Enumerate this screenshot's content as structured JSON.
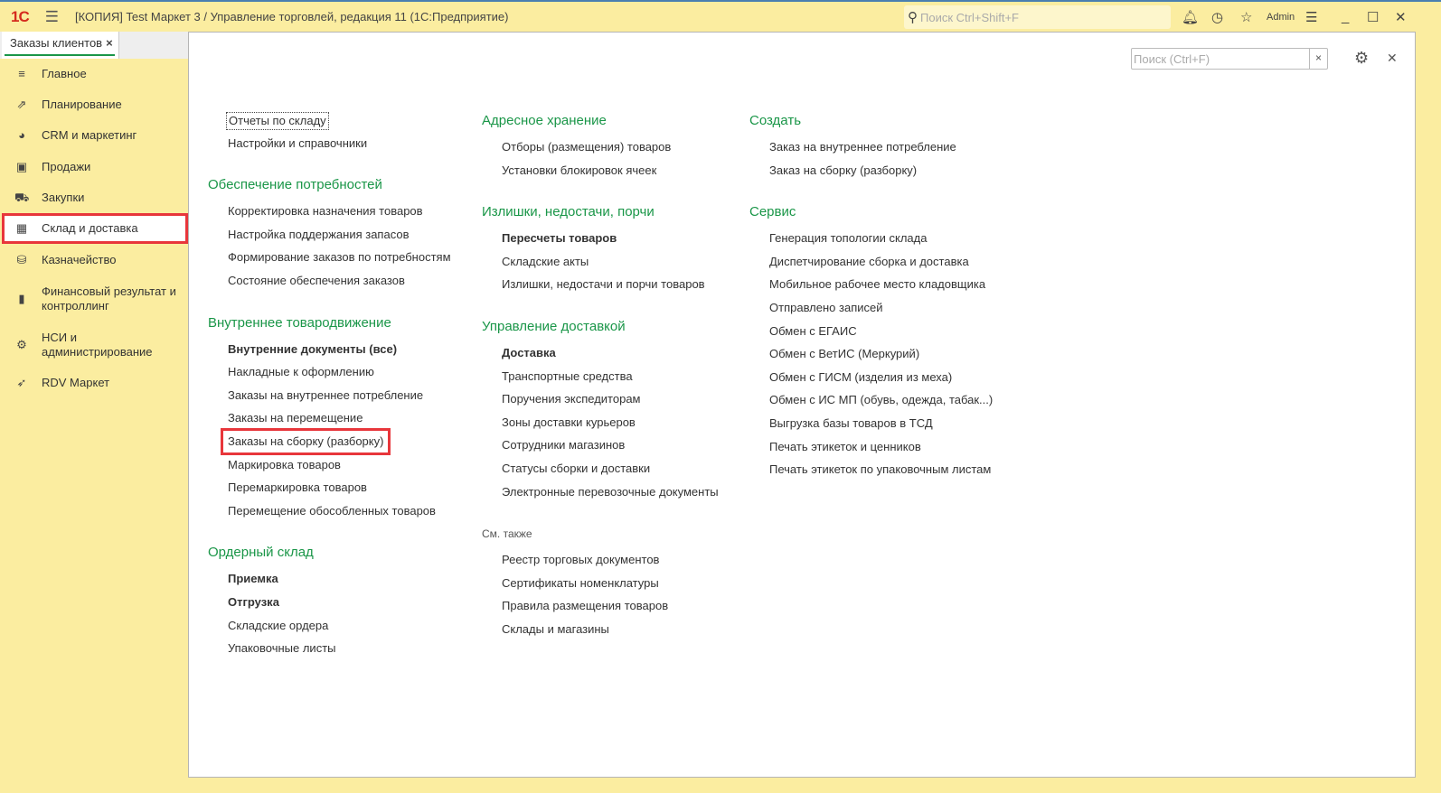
{
  "titlebar": {
    "title": "[КОПИЯ] Test Маркет 3 / Управление торговлей, редакция 11  (1С:Предприятие)",
    "search_placeholder": "Поиск Ctrl+Shift+F",
    "user": "Admin"
  },
  "tabs": [
    {
      "label": "Заказы клиентов"
    }
  ],
  "sidebar": {
    "items": [
      {
        "label": "Главное",
        "icon": "≡"
      },
      {
        "label": "Планирование",
        "icon": "⇗"
      },
      {
        "label": "CRM и маркетинг",
        "icon": "◕"
      },
      {
        "label": "Продажи",
        "icon": "▣"
      },
      {
        "label": "Закупки",
        "icon": "⛟"
      },
      {
        "label": "Склад и доставка",
        "icon": "▦",
        "selected": true
      },
      {
        "label": "Казначейство",
        "icon": "⛁"
      },
      {
        "label": "Финансовый результат и контроллинг",
        "icon": "▮"
      },
      {
        "label": "НСИ и администрирование",
        "icon": "⚙"
      },
      {
        "label": "RDV Маркет",
        "icon": "➶"
      }
    ]
  },
  "panel": {
    "search_placeholder": "Поиск (Ctrl+F)"
  },
  "columns": [
    {
      "sections": [
        {
          "heading": "",
          "items": [
            {
              "label": "Отчеты по складу",
              "focus": true
            },
            {
              "label": "Настройки и справочники"
            }
          ]
        },
        {
          "heading": "Обеспечение потребностей",
          "items": [
            {
              "label": "Корректировка назначения товаров"
            },
            {
              "label": "Настройка поддержания запасов"
            },
            {
              "label": "Формирование заказов по потребностям"
            },
            {
              "label": "Состояние обеспечения заказов"
            }
          ]
        },
        {
          "heading": "Внутреннее товародвижение",
          "items": [
            {
              "label": "Внутренние документы (все)",
              "bold": true
            },
            {
              "label": "Накладные к оформлению"
            },
            {
              "label": "Заказы на внутреннее потребление"
            },
            {
              "label": "Заказы на перемещение"
            },
            {
              "label": "Заказы на сборку (разборку)",
              "highlighted": true
            },
            {
              "label": "Маркировка товаров"
            },
            {
              "label": "Перемаркировка товаров"
            },
            {
              "label": "Перемещение обособленных товаров"
            }
          ]
        },
        {
          "heading": "Ордерный склад",
          "items": [
            {
              "label": "Приемка",
              "bold": true
            },
            {
              "label": "Отгрузка",
              "bold": true
            },
            {
              "label": "Складские ордера"
            },
            {
              "label": "Упаковочные листы"
            }
          ]
        }
      ]
    },
    {
      "sections": [
        {
          "heading": "Адресное хранение",
          "items": [
            {
              "label": "Отборы (размещения) товаров"
            },
            {
              "label": "Установки блокировок ячеек"
            }
          ]
        },
        {
          "heading": "Излишки, недостачи, порчи",
          "items": [
            {
              "label": "Пересчеты товаров",
              "bold": true
            },
            {
              "label": "Складские акты"
            },
            {
              "label": "Излишки, недостачи и порчи товаров"
            }
          ]
        },
        {
          "heading": "Управление доставкой",
          "items": [
            {
              "label": "Доставка",
              "bold": true
            },
            {
              "label": "Транспортные средства"
            },
            {
              "label": "Поручения экспедиторам"
            },
            {
              "label": "Зоны доставки курьеров"
            },
            {
              "label": "Сотрудники магазинов"
            },
            {
              "label": "Статусы сборки и доставки"
            },
            {
              "label": "Электронные перевозочные документы"
            }
          ]
        },
        {
          "heading": "См. также",
          "gray": true,
          "items": [
            {
              "label": "Реестр торговых документов"
            },
            {
              "label": "Сертификаты номенклатуры"
            },
            {
              "label": "Правила размещения товаров"
            },
            {
              "label": "Склады и магазины"
            }
          ]
        }
      ]
    },
    {
      "sections": [
        {
          "heading": "Создать",
          "items": [
            {
              "label": "Заказ на внутреннее потребление"
            },
            {
              "label": "Заказ на сборку (разборку)"
            }
          ]
        },
        {
          "heading": "Сервис",
          "items": [
            {
              "label": "Генерация топологии склада"
            },
            {
              "label": "Диспетчирование сборка и доставка"
            },
            {
              "label": "Мобильное рабочее место кладовщика"
            },
            {
              "label": "Отправлено записей"
            },
            {
              "label": "Обмен с ЕГАИС"
            },
            {
              "label": "Обмен с ВетИС (Меркурий)"
            },
            {
              "label": "Обмен с ГИСМ (изделия из меха)"
            },
            {
              "label": "Обмен с ИС МП (обувь, одежда, табак...)"
            },
            {
              "label": "Выгрузка базы товаров в ТСД"
            },
            {
              "label": "Печать этикеток и ценников"
            },
            {
              "label": "Печать этикеток по упаковочным листам"
            }
          ]
        }
      ]
    }
  ]
}
